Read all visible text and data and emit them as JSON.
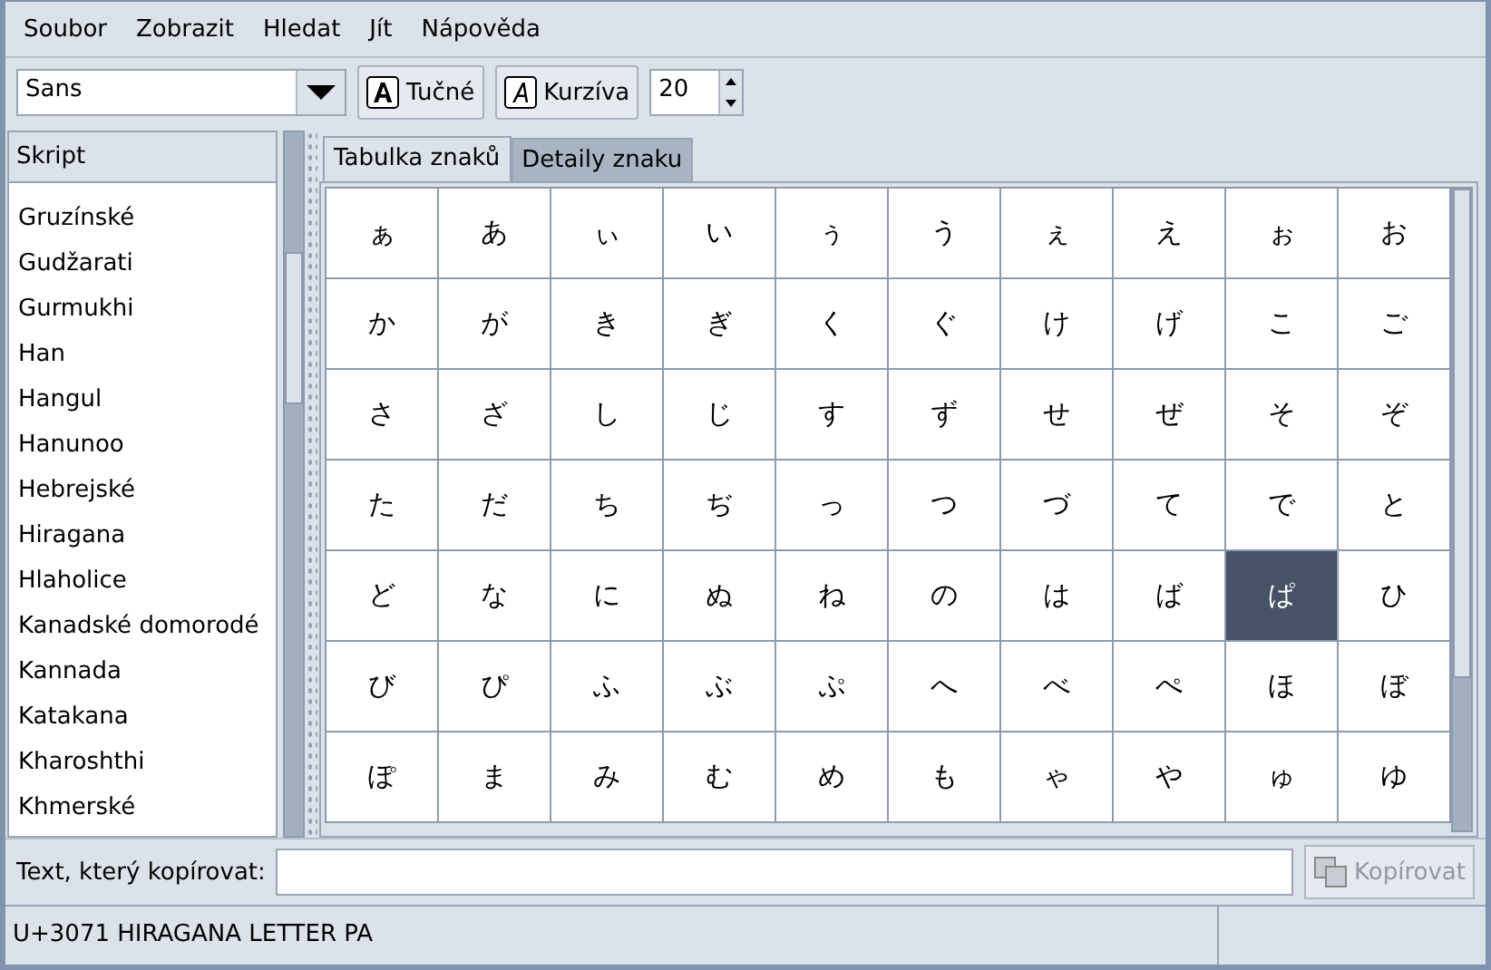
{
  "menu": [
    {
      "label": "Soubor"
    },
    {
      "label": "Zobrazit"
    },
    {
      "label": "Hledat"
    },
    {
      "label": "Jít"
    },
    {
      "label": "Nápověda"
    }
  ],
  "toolbar": {
    "font": {
      "value": "Sans"
    },
    "bold_button": {
      "label": "Tučné"
    },
    "italic_button": {
      "label": "Kurzíva"
    },
    "size": {
      "value": "20"
    }
  },
  "script_list": {
    "header": "Skript",
    "items": [
      {
        "label": "Gruzínské",
        "selected": false
      },
      {
        "label": "Gudžarati",
        "selected": false
      },
      {
        "label": "Gurmukhi",
        "selected": false
      },
      {
        "label": "Han",
        "selected": false
      },
      {
        "label": "Hangul",
        "selected": false
      },
      {
        "label": "Hanunoo",
        "selected": false
      },
      {
        "label": "Hebrejské",
        "selected": false
      },
      {
        "label": "Hiragana",
        "selected": false
      },
      {
        "label": "Hlaholice",
        "selected": false
      },
      {
        "label": "Kanadské domorodé",
        "selected": false
      },
      {
        "label": "Kannada",
        "selected": false
      },
      {
        "label": "Katakana",
        "selected": false
      },
      {
        "label": "Kharoshthi",
        "selected": false
      },
      {
        "label": "Khmerské",
        "selected": false
      }
    ]
  },
  "tabs": [
    {
      "label": "Tabulka znaků",
      "selected": true
    },
    {
      "label": "Detaily znaku",
      "selected": false
    }
  ],
  "characters": [
    {
      "char": "ぁ",
      "selected": false
    },
    {
      "char": "あ",
      "selected": false
    },
    {
      "char": "ぃ",
      "selected": false
    },
    {
      "char": "い",
      "selected": false
    },
    {
      "char": "ぅ",
      "selected": false
    },
    {
      "char": "う",
      "selected": false
    },
    {
      "char": "ぇ",
      "selected": false
    },
    {
      "char": "え",
      "selected": false
    },
    {
      "char": "ぉ",
      "selected": false
    },
    {
      "char": "お",
      "selected": false
    },
    {
      "char": "か",
      "selected": false
    },
    {
      "char": "が",
      "selected": false
    },
    {
      "char": "き",
      "selected": false
    },
    {
      "char": "ぎ",
      "selected": false
    },
    {
      "char": "く",
      "selected": false
    },
    {
      "char": "ぐ",
      "selected": false
    },
    {
      "char": "け",
      "selected": false
    },
    {
      "char": "げ",
      "selected": false
    },
    {
      "char": "こ",
      "selected": false
    },
    {
      "char": "ご",
      "selected": false
    },
    {
      "char": "さ",
      "selected": false
    },
    {
      "char": "ざ",
      "selected": false
    },
    {
      "char": "し",
      "selected": false
    },
    {
      "char": "じ",
      "selected": false
    },
    {
      "char": "す",
      "selected": false
    },
    {
      "char": "ず",
      "selected": false
    },
    {
      "char": "せ",
      "selected": false
    },
    {
      "char": "ぜ",
      "selected": false
    },
    {
      "char": "そ",
      "selected": false
    },
    {
      "char": "ぞ",
      "selected": false
    },
    {
      "char": "た",
      "selected": false
    },
    {
      "char": "だ",
      "selected": false
    },
    {
      "char": "ち",
      "selected": false
    },
    {
      "char": "ぢ",
      "selected": false
    },
    {
      "char": "っ",
      "selected": false
    },
    {
      "char": "つ",
      "selected": false
    },
    {
      "char": "づ",
      "selected": false
    },
    {
      "char": "て",
      "selected": false
    },
    {
      "char": "で",
      "selected": false
    },
    {
      "char": "と",
      "selected": false
    },
    {
      "char": "ど",
      "selected": false
    },
    {
      "char": "な",
      "selected": false
    },
    {
      "char": "に",
      "selected": false
    },
    {
      "char": "ぬ",
      "selected": false
    },
    {
      "char": "ね",
      "selected": false
    },
    {
      "char": "の",
      "selected": false
    },
    {
      "char": "は",
      "selected": false
    },
    {
      "char": "ば",
      "selected": false
    },
    {
      "char": "ぱ",
      "selected": true
    },
    {
      "char": "ひ",
      "selected": false
    },
    {
      "char": "び",
      "selected": false
    },
    {
      "char": "ぴ",
      "selected": false
    },
    {
      "char": "ふ",
      "selected": false
    },
    {
      "char": "ぶ",
      "selected": false
    },
    {
      "char": "ぷ",
      "selected": false
    },
    {
      "char": "へ",
      "selected": false
    },
    {
      "char": "べ",
      "selected": false
    },
    {
      "char": "ぺ",
      "selected": false
    },
    {
      "char": "ほ",
      "selected": false
    },
    {
      "char": "ぼ",
      "selected": false
    },
    {
      "char": "ぽ",
      "selected": false
    },
    {
      "char": "ま",
      "selected": false
    },
    {
      "char": "み",
      "selected": false
    },
    {
      "char": "む",
      "selected": false
    },
    {
      "char": "め",
      "selected": false
    },
    {
      "char": "も",
      "selected": false
    },
    {
      "char": "ゃ",
      "selected": false
    },
    {
      "char": "や",
      "selected": false
    },
    {
      "char": "ゅ",
      "selected": false
    },
    {
      "char": "ゆ",
      "selected": false
    }
  ],
  "copy_bar": {
    "label": "Text, který kopírovat:",
    "button": {
      "label": "Kopírovat",
      "disabled": true
    }
  },
  "status_bar": {
    "text": "U+3071 HIRAGANA LETTER PA"
  }
}
